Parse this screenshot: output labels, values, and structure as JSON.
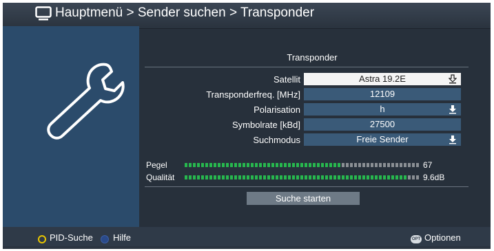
{
  "header": {
    "title": "Hauptmenü > Sender suchen > Transponder",
    "icon": "tv-icon"
  },
  "side_icon": "wrench-icon",
  "section": {
    "title": "Transponder"
  },
  "fields": [
    {
      "label": "Satellit",
      "value": "Astra 19.2E",
      "selected": true,
      "dropdown": true
    },
    {
      "label": "Transponderfreq. [MHz]",
      "value": "12109",
      "selected": false,
      "dropdown": false
    },
    {
      "label": "Polarisation",
      "value": "h",
      "selected": false,
      "dropdown": true
    },
    {
      "label": "Symbolrate [kBd]",
      "value": "27500",
      "selected": false,
      "dropdown": false
    },
    {
      "label": "Suchmodus",
      "value": "Freie Sender",
      "selected": false,
      "dropdown": true
    }
  ],
  "meters": {
    "level": {
      "label": "Pegel",
      "value": "67",
      "fill_fraction": 0.67
    },
    "quality": {
      "label": "Qualität",
      "value": "9.6dB",
      "fill_fraction": 0.95
    }
  },
  "search_button": "Suche starten",
  "footer": {
    "yellow_label": "PID-Suche",
    "blue_label": "Hilfe",
    "opt_badge": "OPT",
    "options_label": "Optionen"
  },
  "colors": {
    "background": "#27303b",
    "side_panel": "#2b4b6b",
    "field": "#3a5a78",
    "meter_on": "#27b84e",
    "meter_off": "#8a8f94",
    "yellow": "#e9c600"
  }
}
